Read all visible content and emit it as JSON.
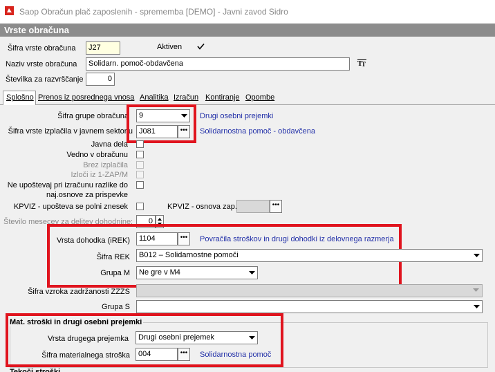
{
  "window": {
    "title": "Saop Obračun plač zaposlenih - sprememba [DEMO] - Javni zavod Sidro"
  },
  "section": {
    "title": "Vrste obračuna"
  },
  "top": {
    "sifra_label": "Šifra vrste obračuna",
    "sifra_value": "J27",
    "aktiven_label": "Aktiven",
    "aktiven_checked": true,
    "naziv_label": "Naziv vrste obračuna",
    "naziv_value": "Solidarn. pomoč-obdavčena",
    "stevilka_label": "Številka  za razvrščanje",
    "stevilka_value": "0"
  },
  "tabs": [
    {
      "label": "Splošno",
      "active": true
    },
    {
      "label": "Prenos iz posrednega vnosa",
      "active": false
    },
    {
      "label": "Analitika",
      "active": false
    },
    {
      "label": "Izračun",
      "active": false
    },
    {
      "label": "Kontiranje",
      "active": false
    },
    {
      "label": "Opombe",
      "active": false
    }
  ],
  "general": {
    "grupa_label": "Šifra grupe obračuna",
    "grupa_value": "9",
    "grupa_desc": "Drugi osebni prejemki",
    "izplacila_label": "Šifra vrste izplačila v javnem sektorju",
    "izplacila_value": "J081",
    "izplacila_desc": "Solidarnostna pomoč - obdavčena",
    "javna_dela_label": "Javna dela",
    "vedno_label": "Vedno v obračunu",
    "brez_label": "Brez izplačila",
    "izloci_label": "Izloči iz 1-ZAP/M",
    "ne_upostevaj_label_1": "Ne upoštevaj pri izračunu razlike do",
    "ne_upostevaj_label_2": "naj.osnove za prispevke",
    "kpviz_label": "KPVIZ - upošteva se polni znesek",
    "kpviz_osnova_label": "KPVIZ - osnova zap.",
    "stevilo_label": "Število mesecev za delitev dohodnine:",
    "stevilo_value": "0",
    "dohodka_label": "Vrsta dohodka (iREK)",
    "dohodka_value": "1104",
    "dohodka_desc": "Povračila stroškov in drugi dohodki iz delovnega razmerja",
    "rek_label": "Šifra REK",
    "rek_value": "B012 – Solidarnostne pomoči",
    "grupa_m_label": "Grupa M",
    "grupa_m_value": "Ne gre v M4",
    "zzzs_label": "Šifra vzroka zadržanosti ZZZS",
    "zzzs_value": "",
    "grupa_s_label": "Grupa S",
    "grupa_s_value": ""
  },
  "mat": {
    "group_title": "Mat. stroški in drugi osebni prejemki",
    "vrsta_label": "Vrsta drugega prejemka",
    "vrsta_value": "Drugi osebni prejemek",
    "sifra_label": "Šifra materialnega stroška",
    "sifra_value": "004",
    "sifra_desc": "Solidarnostna pomoč"
  },
  "bottom": {
    "partial_label": "Tekoči stroški"
  },
  "icons": {
    "app": "app-icon",
    "translate": "translate-icon"
  },
  "colors": {
    "highlight": "#e0141e",
    "link": "#2230a8",
    "header": "#8c8c8c"
  }
}
